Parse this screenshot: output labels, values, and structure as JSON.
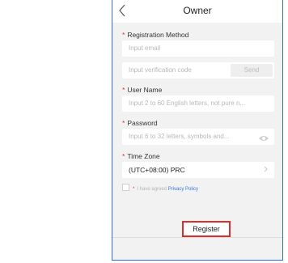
{
  "header": {
    "title": "Owner",
    "back_icon": "chevron-left-icon"
  },
  "form": {
    "registration_method": {
      "label": "Registration Method",
      "email_placeholder": "Input email",
      "code_placeholder": "Input verification code",
      "send_label": "Send"
    },
    "user_name": {
      "label": "User Name",
      "placeholder": "Input 2 to 60 English letters, not pure n..."
    },
    "password": {
      "label": "Password",
      "placeholder": "Input 6 to 32 letters, symbols and...",
      "icon": "eye-icon"
    },
    "time_zone": {
      "label": "Time Zone",
      "value": "(UTC+08:00) PRC"
    },
    "agreement": {
      "text": "I have agreed",
      "link": "Privacy Policy"
    },
    "required_marker": "*"
  },
  "actions": {
    "register_label": "Register"
  },
  "colors": {
    "required": "#e0312c",
    "link": "#3c76d8",
    "highlight_border": "#d9302b",
    "frame": "#2f6fd6"
  }
}
